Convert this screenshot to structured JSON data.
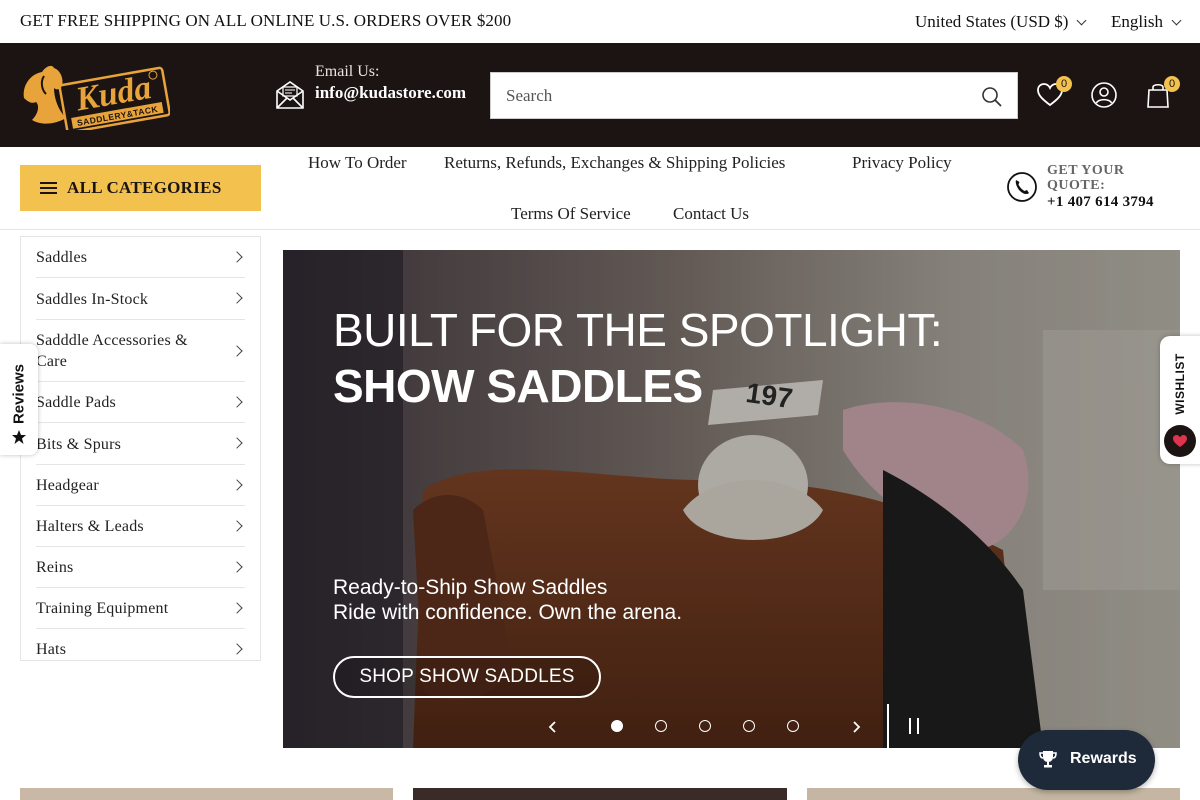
{
  "announcement": {
    "message": "GET FREE SHIPPING ON ALL ONLINE U.S. ORDERS OVER $200",
    "currency": "United States (USD $)",
    "language": "English"
  },
  "header": {
    "logo_alt": "Kuda Saddlery & Tack",
    "email_label": "Email Us:",
    "email_value": "info@kudastore.com",
    "search_placeholder": "Search",
    "wishlist_count": "0",
    "cart_count": "0"
  },
  "nav": {
    "all_categories_label": "ALL CATEGORIES",
    "links": [
      "How To Order",
      "Returns, Refunds, Exchanges & Shipping Policies",
      "Privacy Policy",
      "Terms Of Service",
      "Contact Us"
    ],
    "quote_label": "GET YOUR QUOTE:",
    "quote_phone": "+1 407 614 3794"
  },
  "sidebar": {
    "items": [
      "Saddles",
      "Saddles In-Stock",
      "Sadddle Accessories & Care",
      "Saddle Pads",
      "Bits & Spurs",
      "Headgear",
      "Halters & Leads",
      "Reins",
      "Training Equipment",
      "Hats"
    ]
  },
  "hero": {
    "headline_line1": "BUILT FOR THE SPOTLIGHT:",
    "headline_line2": "SHOW SADDLES",
    "bib_number": "197",
    "subtext_line1": "Ready-to-Ship Show Saddles",
    "subtext_line2": "Ride with confidence. Own the arena.",
    "cta_label": "SHOP SHOW SADDLES",
    "slide_count": 5,
    "active_slide": 1
  },
  "floating": {
    "reviews_label": "Reviews",
    "wishlist_label": "WISHLIST",
    "rewards_label": "Rewards"
  },
  "colors": {
    "header_bg": "#1c1412",
    "accent_yellow": "#f2c14e",
    "logo_orange": "#e8a43a",
    "rewards_bg": "#1e2a3a",
    "heart_red": "#e0334f"
  }
}
